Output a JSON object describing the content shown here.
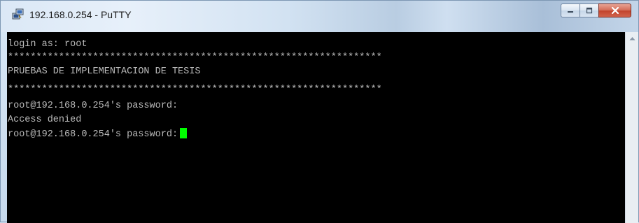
{
  "window": {
    "title": "192.168.0.254 - PuTTY",
    "icon": "putty-icon"
  },
  "controls": {
    "minimize": "minimize-icon",
    "maximize": "maximize-icon",
    "close": "close-icon"
  },
  "terminal": {
    "lines": [
      "login as: root",
      "******************************************************************",
      "PRUEBAS DE IMPLEMENTACION DE TESIS",
      "******************************************************************",
      "root@192.168.0.254's password:",
      "Access denied",
      "root@192.168.0.254's password:"
    ],
    "text_color": "#bbbbbb",
    "cursor_color": "#00ff00",
    "background": "#000000"
  },
  "scrollbar": {
    "up_icon": "scroll-up-arrow-icon"
  }
}
